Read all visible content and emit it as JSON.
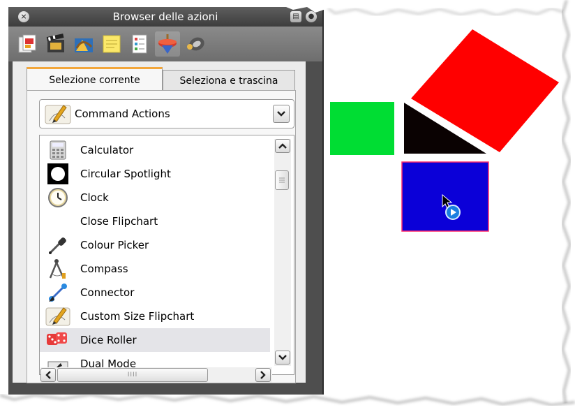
{
  "panel": {
    "title": "Browser delle azioni",
    "close_glyph": "×",
    "toolbar": [
      {
        "icon": "page-browser-icon"
      },
      {
        "icon": "resource-browser-icon"
      },
      {
        "icon": "object-browser-icon"
      },
      {
        "icon": "notes-browser-icon"
      },
      {
        "icon": "property-browser-icon"
      },
      {
        "icon": "action-browser-icon",
        "active": true
      },
      {
        "icon": "voting-browser-icon"
      }
    ],
    "tabs": {
      "current": "Selezione corrente",
      "drag": "Seleziona e trascina"
    },
    "category_select": {
      "selected": "Command Actions"
    },
    "actions": [
      {
        "label": "Calculator",
        "icon": "calculator-icon"
      },
      {
        "label": "Circular Spotlight",
        "icon": "spotlight-icon"
      },
      {
        "label": "Clock",
        "icon": "clock-icon"
      },
      {
        "label": "Close Flipchart",
        "icon": ""
      },
      {
        "label": "Colour Picker",
        "icon": "eyedropper-icon"
      },
      {
        "label": "Compass",
        "icon": "compass-icon"
      },
      {
        "label": "Connector",
        "icon": "connector-icon"
      },
      {
        "label": "Custom Size Flipchart",
        "icon": "flipchart-icon"
      },
      {
        "label": "Dice Roller",
        "icon": "dice-icon",
        "highlighted": true
      },
      {
        "label": "Dual Mode",
        "icon": "dual-mode-icon"
      }
    ],
    "hscroll_grip": "IIII"
  },
  "canvas": {
    "colors": {
      "red": "#ff0000",
      "green": "#00dd33",
      "black": "#0a0202",
      "blue": "#0b00d8",
      "blue_border": "#ff2a6a"
    }
  }
}
